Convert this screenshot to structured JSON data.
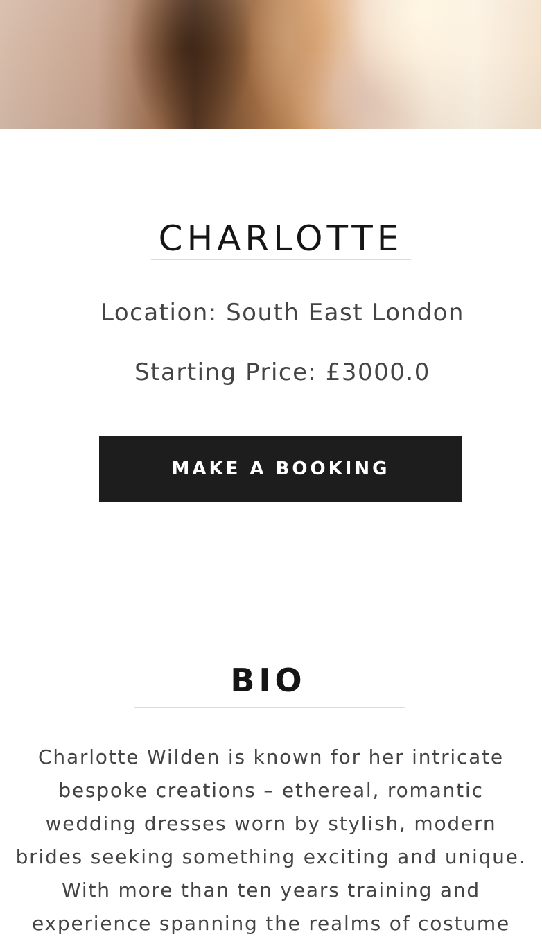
{
  "profile": {
    "name": "CHARLOTTE",
    "location": "Location: South East London",
    "price": "Starting Price: £3000.0",
    "booking_label": "MAKE A BOOKING"
  },
  "bio": {
    "heading": "BIO",
    "lines": [
      "Charlotte Wilden is known for her intricate",
      "bespoke creations – ethereal, romantic",
      "wedding dresses worn by stylish, modern",
      "brides seeking something exciting and unique.",
      "With more than ten years training and",
      "experience spanning the realms of costume"
    ]
  }
}
